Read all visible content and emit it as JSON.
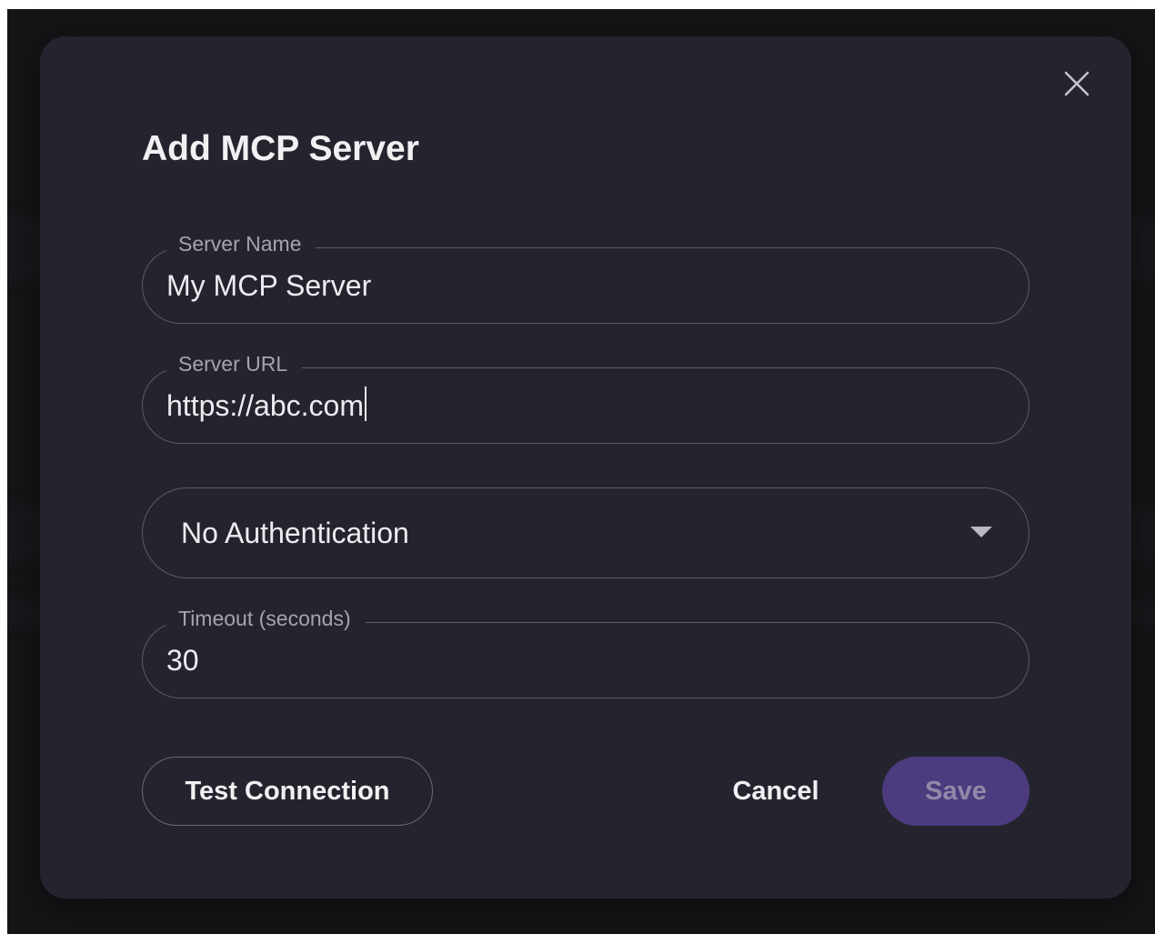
{
  "dialog": {
    "title": "Add MCP Server",
    "close_icon": "close-icon"
  },
  "fields": {
    "server_name": {
      "label": "Server Name",
      "value": "My MCP Server"
    },
    "server_url": {
      "label": "Server URL",
      "value": "https://abc.com"
    },
    "auth": {
      "selected": "No Authentication",
      "icon": "chevron-down-icon"
    },
    "timeout": {
      "label": "Timeout (seconds)",
      "value": "30"
    }
  },
  "actions": {
    "test_label": "Test Connection",
    "cancel_label": "Cancel",
    "save_label": "Save"
  },
  "colors": {
    "dialog_background": "#24242e",
    "backdrop": "#151518",
    "save_button_background": "#4c3b7e",
    "field_border": "#5c5c66"
  }
}
